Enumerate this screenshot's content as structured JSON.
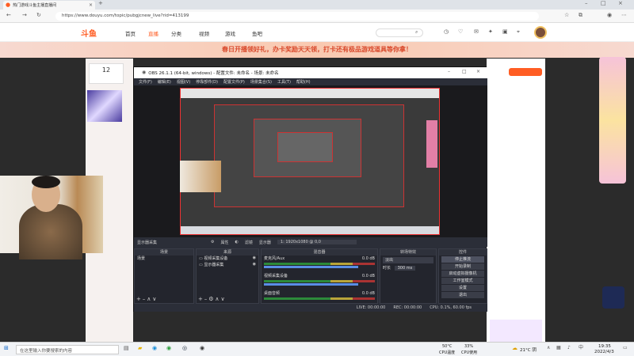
{
  "browser": {
    "tab_title": "热门游戏斗鱼主播直播间",
    "url": "https://www.douyu.com/topic/pubgjcnew_live?rid=413199"
  },
  "site": {
    "logo": "斗鱼",
    "nav": [
      "首页",
      "直播",
      "分类",
      "视频",
      "游戏",
      "鱼吧"
    ],
    "banner": "春日开播领好礼，办卡奖励天天领，打卡还有极品游戏道具等你拿！",
    "follow_count": "12"
  },
  "obs": {
    "title": "OBS 26.1.1 (64-bit, windows) - 配置文件: 未命名 - 场景: 未命名",
    "menu": [
      "文件(F)",
      "编辑(E)",
      "视图(V)",
      "停靠部件(D)",
      "配置文件(P)",
      "场景集合(S)",
      "工具(T)",
      "帮助(H)"
    ],
    "source_bar": {
      "label": "显示器采集",
      "props": "属性",
      "filter": "滤镜",
      "display_label": "显示器",
      "display_value": "1: 1920x1080 @ 0,0"
    },
    "scenes": {
      "header": "场景",
      "items": [
        "场景"
      ]
    },
    "sources": {
      "header": "来源",
      "items": [
        "视频采集设备",
        "显示器采集"
      ]
    },
    "mixer": {
      "header": "混音器",
      "channels": [
        {
          "name": "麦克风/Aux",
          "db": "0.0 dB"
        },
        {
          "name": "视频采集设备",
          "db": "0.0 dB"
        },
        {
          "name": "桌面音频",
          "db": "0.0 dB"
        }
      ]
    },
    "transition": {
      "header": "转场特效",
      "type": "淡出",
      "duration_label": "时长",
      "duration": "300 ms"
    },
    "controls": {
      "header": "控件",
      "buttons": [
        "停止推流",
        "开始录制",
        "启动虚拟摄像机",
        "工作室模式",
        "设置",
        "退出"
      ]
    },
    "status": {
      "live": "LIVE: 00:00:00",
      "rec": "REC: 00:00:00",
      "cpu": "CPU: 0.1%, 60.00 fps"
    }
  },
  "taskbar": {
    "search": "在这里输入你要搜索的内容",
    "weather": "21°C 阴",
    "cpu_temp": "50°C",
    "cpu_label": "CPU温度",
    "cpu_usage": "33%",
    "cpu_usage_label": "CPU使用",
    "time": "19:35",
    "date": "2022/4/3"
  },
  "colors": {
    "accent": "#ff5d23",
    "obs_bg": "#2b2e38",
    "taskbar": "#f1f3f6"
  }
}
